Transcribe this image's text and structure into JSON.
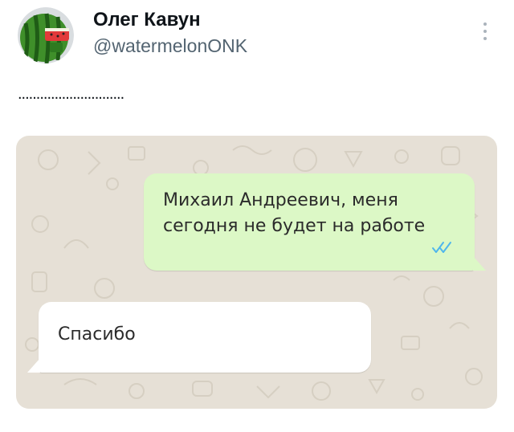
{
  "post": {
    "author_name": "Олег Кавун",
    "author_handle": "@watermelonONK",
    "text": ".............................",
    "more_icon": "more-vertical-icon"
  },
  "chat": {
    "messages": [
      {
        "direction": "outgoing",
        "text": "Михаил Андреевич, меня сегодня не будет на работе",
        "status_icon": "double-check-icon",
        "status": "read"
      },
      {
        "direction": "incoming",
        "text": "Спасибо"
      }
    ]
  },
  "colors": {
    "outgoing_bubble": "#dcf8c6",
    "incoming_bubble": "#ffffff",
    "chat_wallpaper": "#e6e0d6",
    "read_ticks": "#4fb6ec",
    "handle": "#536471"
  }
}
